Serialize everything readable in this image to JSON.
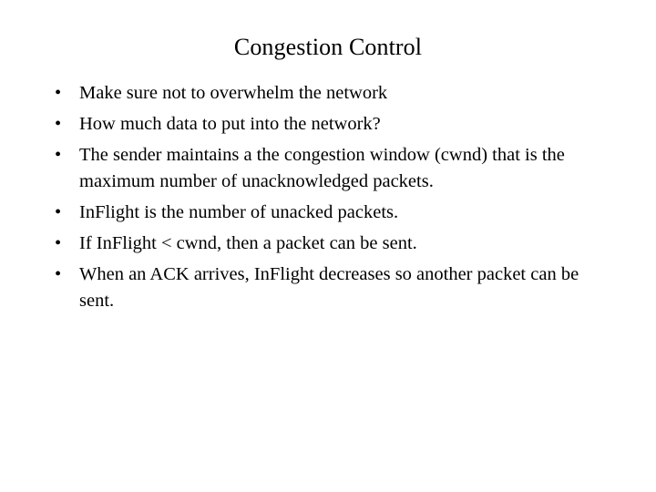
{
  "slide": {
    "title": "Congestion Control",
    "background_color": "#ffffff",
    "text_color": "#000000",
    "bullet_glyph": "•",
    "bullets": [
      {
        "text": "Make sure not to overwhelm the network"
      },
      {
        "text": "How much data to put into the network?"
      },
      {
        "text": "The sender maintains a the congestion window (cwnd) that is the maximum number of unacknowledged packets."
      },
      {
        "text": "InFlight is the number of unacked packets."
      },
      {
        "text": "If InFlight < cwnd, then a packet can be sent."
      },
      {
        "text": "When an ACK arrives, InFlight decreases so another packet can be sent."
      }
    ]
  }
}
